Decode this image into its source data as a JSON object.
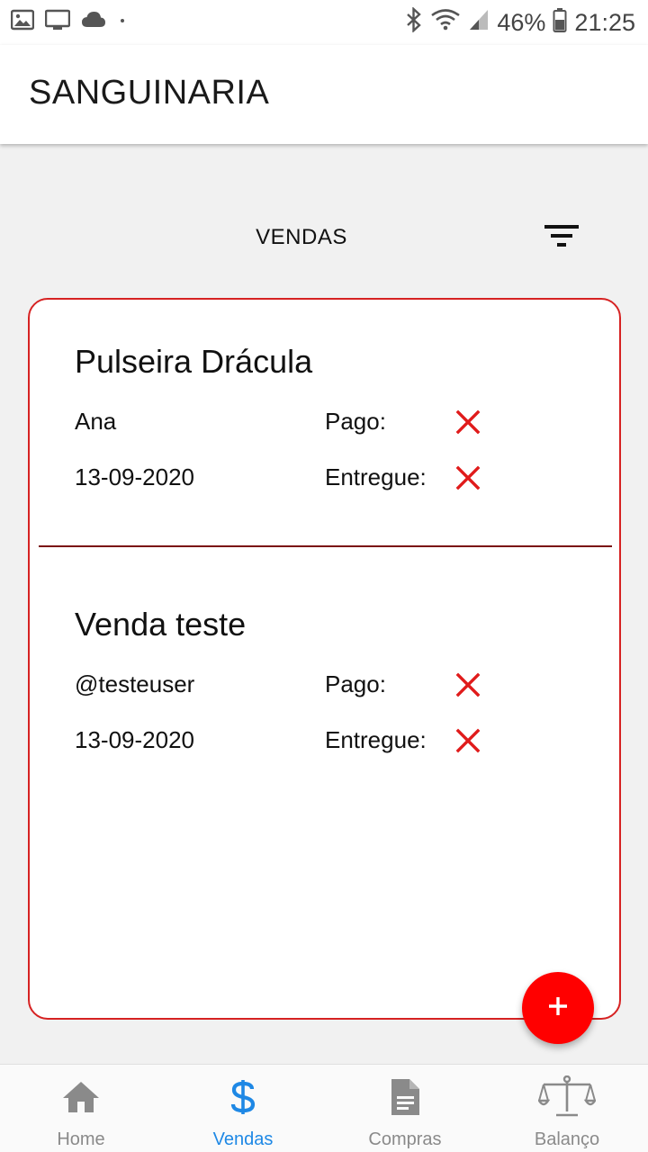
{
  "status_bar": {
    "battery": "46%",
    "time": "21:25"
  },
  "app": {
    "title": "SANGUINARIA"
  },
  "page": {
    "section_title": "VENDAS"
  },
  "sales": [
    {
      "title": "Pulseira Drácula",
      "customer": "Ana",
      "date": "13-09-2020",
      "paid_label": "Pago:",
      "delivered_label": "Entregue:",
      "paid": false,
      "delivered": false
    },
    {
      "title": "Venda teste",
      "customer": "@testeuser",
      "date": "13-09-2020",
      "paid_label": "Pago:",
      "delivered_label": "Entregue:",
      "paid": false,
      "delivered": false
    }
  ],
  "bottom_nav": [
    {
      "label": "Home",
      "icon": "home-icon",
      "active": false
    },
    {
      "label": "Vendas",
      "icon": "dollar-icon",
      "active": true
    },
    {
      "label": "Compras",
      "icon": "document-icon",
      "active": false
    },
    {
      "label": "Balanço",
      "icon": "scale-icon",
      "active": false
    }
  ],
  "colors": {
    "accent_red": "#ff0000",
    "card_border": "#d62222",
    "x_mark": "#e01b1b",
    "active_nav": "#1e88e5",
    "inactive_nav": "#8a8a8a"
  }
}
